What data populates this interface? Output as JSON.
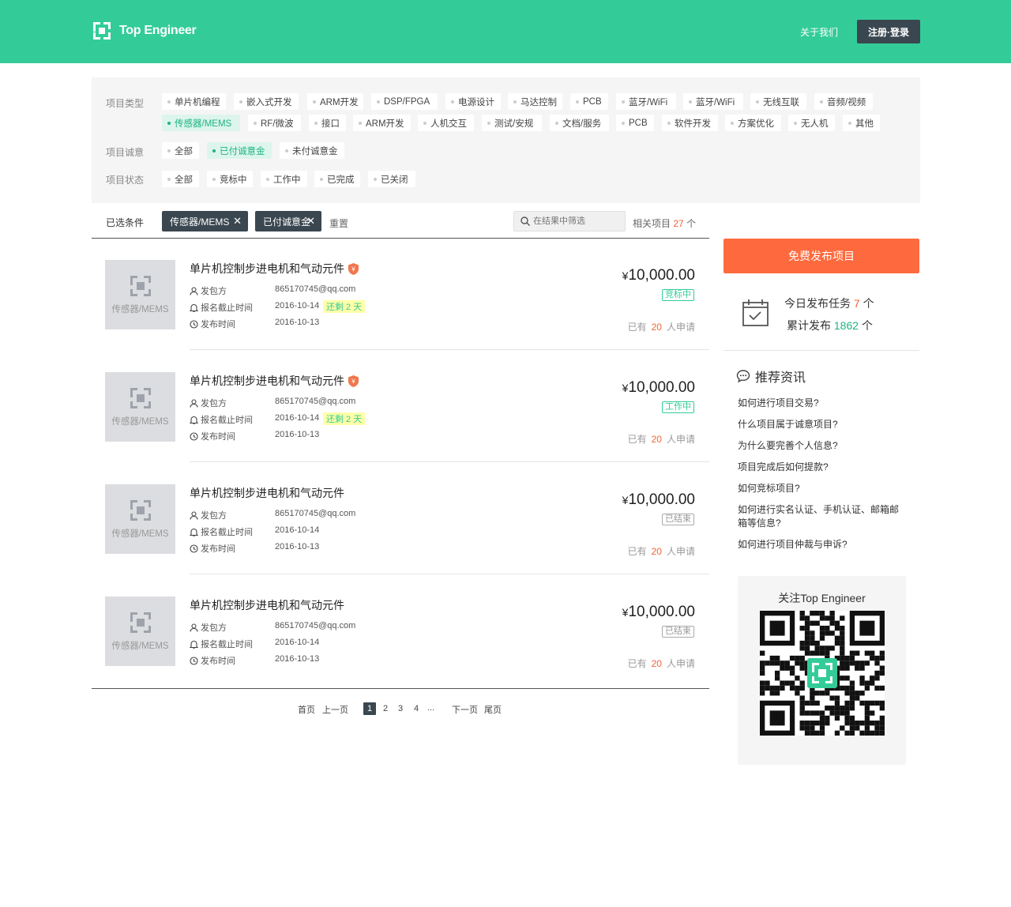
{
  "header": {
    "logo_text": "Top Engineer",
    "about": "关于我们",
    "login": "注册·登录"
  },
  "filters": {
    "type_label": "项目类型",
    "type_tags_row1": [
      "单片机编程",
      "嵌入式开发",
      "ARM开发",
      "DSP/FPGA",
      "电源设计",
      "马达控制",
      "PCB",
      "蓝牙/WiFi",
      "蓝牙/WiFi",
      "无线互联",
      "音频/视频"
    ],
    "type_tags_row2": [
      "传感器/MEMS",
      "RF/微波",
      "接口",
      "ARM开发",
      "人机交互",
      "测试/安规",
      "文档/服务",
      "PCB",
      "软件开发",
      "方案优化",
      "无人机",
      "其他"
    ],
    "intent_label": "项目诚意",
    "intent_tags": [
      "全部",
      "已付诚意金",
      "未付诚意金"
    ],
    "status_label": "项目状态",
    "status_tags": [
      "全部",
      "竞标中",
      "工作中",
      "已完成",
      "已关闭"
    ]
  },
  "conditions": {
    "label": "已选条件",
    "chips": [
      "传感器/MEMS",
      "已付诚意金"
    ],
    "reset": "重置",
    "search_placeholder": "在结果中筛选",
    "related_prefix": "相关项目",
    "related_count": "27",
    "related_suffix": "个"
  },
  "labels": {
    "publisher": "发包方",
    "deadline": "报名截止时间",
    "publish_time": "发布时间",
    "thumb": "传感器/MEMS",
    "apply_prefix": "已有",
    "apply_suffix": "人申请",
    "yen": "¥"
  },
  "projects": [
    {
      "title": "单片机控制步进电机和气动元件",
      "verified": true,
      "publisher": "865170745@qq.com",
      "deadline": "2016-10-14",
      "remain": "还剩 2 天",
      "published": "2016-10-13",
      "price": "10,000.00",
      "status": "竞标中",
      "status_type": "active",
      "applicants": "20"
    },
    {
      "title": "单片机控制步进电机和气动元件",
      "verified": true,
      "publisher": "865170745@qq.com",
      "deadline": "2016-10-14",
      "remain": "还剩 2 天",
      "published": "2016-10-13",
      "price": "10,000.00",
      "status": "工作中",
      "status_type": "active",
      "applicants": "20"
    },
    {
      "title": "单片机控制步进电机和气动元件",
      "verified": false,
      "publisher": "865170745@qq.com",
      "deadline": "2016-10-14",
      "remain": "",
      "published": "2016-10-13",
      "price": "10,000.00",
      "status": "已结束",
      "status_type": "ended",
      "applicants": "20"
    },
    {
      "title": "单片机控制步进电机和气动元件",
      "verified": false,
      "publisher": "865170745@qq.com",
      "deadline": "2016-10-14",
      "remain": "",
      "published": "2016-10-13",
      "price": "10,000.00",
      "status": "已结束",
      "status_type": "ended",
      "applicants": "20"
    }
  ],
  "pagination": {
    "first": "首页",
    "prev": "上一页",
    "pages": [
      "1",
      "2",
      "3",
      "4"
    ],
    "ellipsis": "...",
    "next": "下一页",
    "last": "尾页"
  },
  "sidebar": {
    "publish_button": "免费发布项目",
    "today_prefix": "今日发布任务",
    "today_count": "7",
    "total_prefix": "累计发布",
    "total_count": "1862",
    "unit": "个",
    "rec_title": "推荐资讯",
    "news": [
      "如何进行项目交易?",
      "什么项目属于诚意项目?",
      "为什么要完善个人信息?",
      "项目完成后如何提款?",
      "如何竞标项目?",
      "如何进行实名认证、手机认证、邮箱邮箱等信息?",
      "如何进行项目仲裁与申诉?"
    ],
    "qr_title": "关注Top Engineer"
  },
  "colors": {
    "brand": "#33cc99",
    "dark": "#3a4750",
    "accent": "#fe6a3d"
  }
}
